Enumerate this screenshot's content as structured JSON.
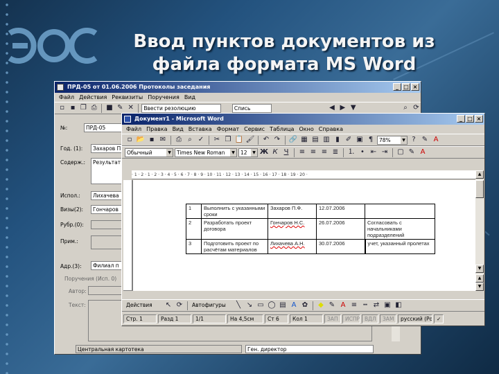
{
  "slide": {
    "title_line1": "Ввод пунктов документов из",
    "title_line2": "файла формата MS Word",
    "logo_text": "ЭОС"
  },
  "back_window": {
    "title": "ПРД-05 от 01.06.2006 Протоколы заседания",
    "menu": [
      "Файл",
      "Действия",
      "Реквизиты",
      "Поручения",
      "Вид"
    ],
    "toolbar_text": "Ввести резолюцию",
    "toolbar_text2": "Спись",
    "fields": {
      "number_label": "№:",
      "number_value": "ПРД-05",
      "date_label": "Год. (1):",
      "date_value": "Захаров П.",
      "content_label": "Содерж.:",
      "content_value": "Результат",
      "author_label": "Испол.:",
      "author_value": "Лихачева",
      "sign_label": "Визы(2):",
      "sign_value": "Гончаров",
      "rubric_label": "Рубр.(0):",
      "note_label": "Прим.:",
      "addr_label": "Адр.(3):",
      "addr_value": "Филиал п",
      "orders_label": "Поручения (Исп. 0)",
      "autor_label": "Автор:",
      "text_label": "Текст:"
    },
    "bottom_label1": "Центральная картотека",
    "bottom_label2": "Ген. директор"
  },
  "word_window": {
    "title": "Документ1 - Microsoft Word",
    "menu": [
      "Файл",
      "Правка",
      "Вид",
      "Вставка",
      "Формат",
      "Сервис",
      "Таблица",
      "Окно",
      "Справка"
    ],
    "zoom": "78%",
    "style": "Обычный",
    "font": "Times New Roman",
    "size": "12",
    "ruler_marks": "· 1 · 2 · 1 · 2 · 3 · 4 · 5 · 6 · 7 · 8 · 9 · 10 · 11 · 12 · 13 · 14 · 15 · 16 · 17 · 18 · 19 · 20 ·",
    "table_rows": [
      [
        "1",
        "Выполнить с указанными сроки",
        "Захаров П.Ф.",
        "12.07.2006",
        ""
      ],
      [
        "2",
        "Разработать проект договора",
        "Гончаров Н.С.",
        "26.07.2006",
        "Согласовать с начальниками подразделений"
      ],
      [
        "3",
        "Подготовить проект по расчётам материалов",
        "Лихачева А.Н.",
        "30.07.2006",
        "учет, указанный пролетах"
      ]
    ],
    "draw_toolbar": {
      "actions": "Действия",
      "autoshapes": "Автофигуры"
    },
    "status": {
      "page": "Стр. 1",
      "section": "Разд 1",
      "pages": "1/1",
      "at": "На 4,5см",
      "line": "Ст 6",
      "col": "Кол 1",
      "rec": "ЗАП",
      "trk": "ИСПР",
      "ext": "ВДЛ",
      "ovr": "ЗАМ",
      "lang": "русский (Ро"
    }
  }
}
